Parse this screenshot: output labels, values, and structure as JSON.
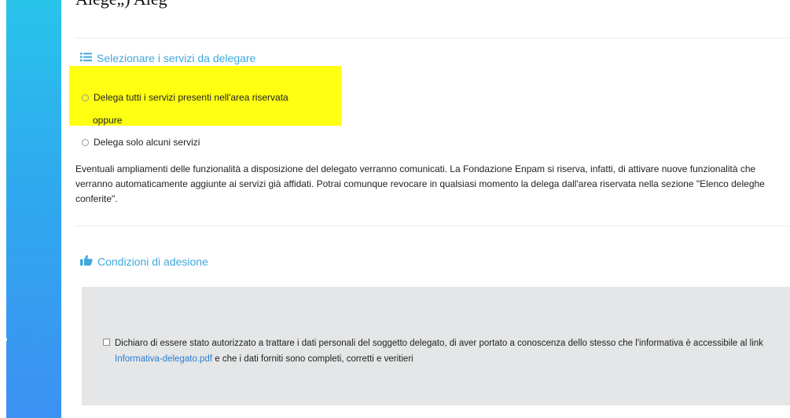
{
  "fragment_top": "Alegè„) Aleg",
  "section_services": {
    "title": "Selezionare i servizi da delegare",
    "option_all": "Delega tutti i servizi presenti nell'area riservata",
    "oppure": "oppure",
    "option_some": "Delega solo alcuni servizi",
    "paragraph": "Eventuali ampliamenti delle funzionalità a disposizione del delegato verranno comunicati. La Fondazione Enpam si riserva, infatti, di attivare nuove funzionalità che verranno automaticamente aggiunte ai servizi già affidati. Potrai comunque revocare in qualsiasi momento la delega dall'area riservata nella sezione \"Elenco deleghe conferite\".",
    "title_icon": "list-icon"
  },
  "section_conditions": {
    "title": "Condizioni di adesione",
    "title_icon": "thumbs-up-icon",
    "declaration_part1": "Dichiaro di essere stato autorizzato a trattare i dati personali del soggetto delegato, di aver portato a conoscenza dello stesso che l'informativa è accessibile al link",
    "link_label": "Informativa-delegato.pdf",
    "declaration_part2": "e che i dati forniti sono completi, corretti e veritieri"
  },
  "colors": {
    "accent": "#3fa8dc",
    "highlight": "#ffff11",
    "link": "#2a7fd4",
    "sidebar": "#2fa9ef",
    "panel": "#e4e6e7"
  }
}
